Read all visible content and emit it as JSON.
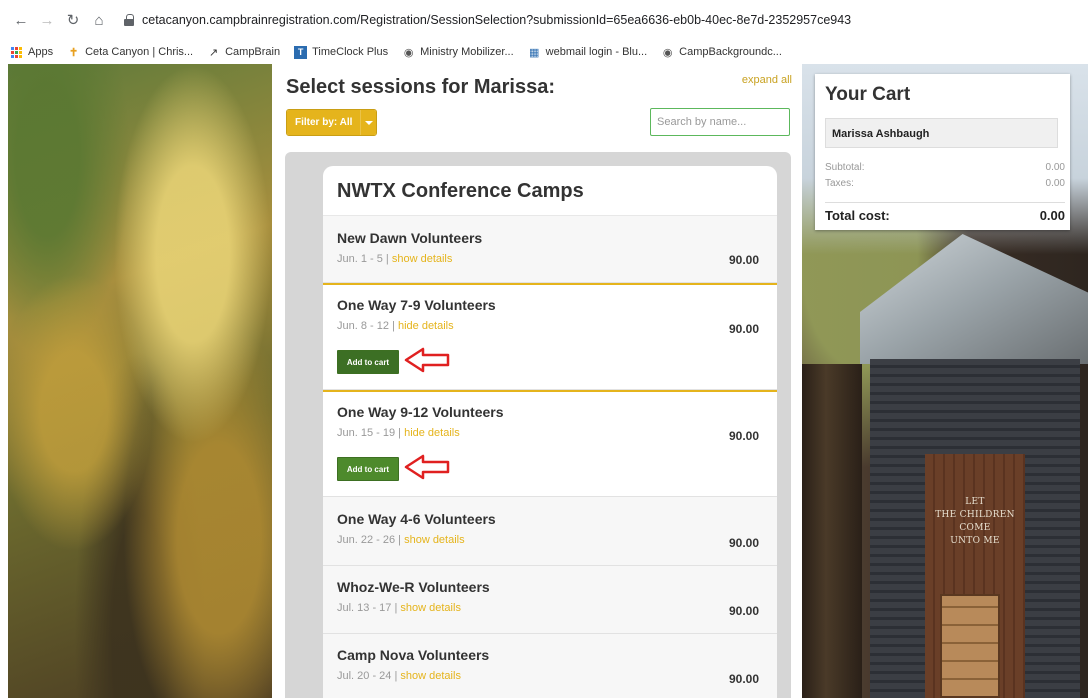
{
  "browser": {
    "url": "cetacanyon.campbrainregistration.com/Registration/SessionSelection?submissionId=65ea6636-eb0b-40ec-8e7d-2352957ce943",
    "bookmarks": [
      "Apps",
      "Ceta Canyon | Chris...",
      "CampBrain",
      "TimeClock Plus",
      "Ministry Mobilizer...",
      "webmail login - Blu...",
      "CampBackgroundc..."
    ]
  },
  "page": {
    "title": "Select sessions for Marissa:",
    "expand_all": "expand all",
    "filter_label": "Filter by: All",
    "search_placeholder": "Search by name...",
    "group_name": "NWTX Conference Camps",
    "sessions": [
      {
        "name": "New Dawn Volunteers",
        "dates": "Jun. 1 - 5",
        "toggle": "show details",
        "price": "90.00"
      },
      {
        "name": "One Way 7-9 Volunteers",
        "dates": "Jun. 8 - 12",
        "toggle": "hide details",
        "price": "90.00",
        "button": "Add to cart"
      },
      {
        "name": "One Way 9-12 Volunteers",
        "dates": "Jun. 15 - 19",
        "toggle": "hide details",
        "price": "90.00",
        "button": "Add to cart"
      },
      {
        "name": "One Way 4-6 Volunteers",
        "dates": "Jun. 22 - 26",
        "toggle": "show details",
        "price": "90.00"
      },
      {
        "name": "Whoz-We-R Volunteers",
        "dates": "Jul. 13 - 17",
        "toggle": "show details",
        "price": "90.00"
      },
      {
        "name": "Camp Nova Volunteers",
        "dates": "Jul. 20 - 24",
        "toggle": "show details",
        "price": "90.00"
      }
    ],
    "accent_color": "#e5b41c",
    "button_color": "#4d8a2c",
    "annotation_color": "#e02020"
  },
  "cart": {
    "title": "Your Cart",
    "camper": "Marissa Ashbaugh",
    "subtotal_label": "Subtotal:",
    "subtotal": "0.00",
    "taxes_label": "Taxes:",
    "taxes": "0.00",
    "total_label": "Total cost:",
    "total": "0.00"
  },
  "background": {
    "church_sign_lines": [
      "LET",
      "THE CHILDREN",
      "COME",
      "UNTO ME"
    ]
  }
}
